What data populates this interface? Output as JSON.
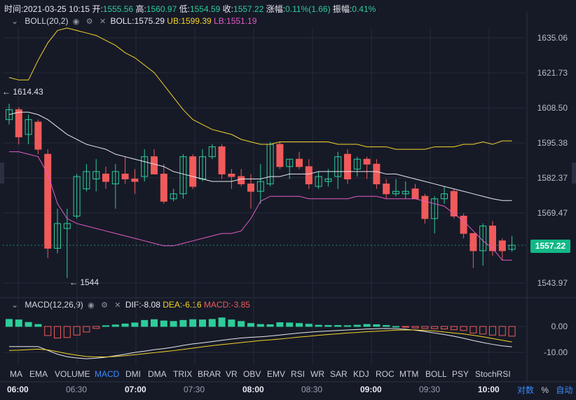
{
  "info": {
    "time_label": "时间:",
    "time": "2021-03-25 10:15",
    "open_label": "开:",
    "open": "1555.56",
    "high_label": "高:",
    "high": "1560.97",
    "low_label": "低:",
    "low": "1554.59",
    "close_label": "收:",
    "close": "1557.22",
    "change_label": "涨幅:",
    "change": "0.11%(1.66)",
    "amplitude_label": "振幅:",
    "amplitude": "0.41%"
  },
  "boll": {
    "name": "BOLL(20,2)",
    "mid": "BOLL:1575.29",
    "ub": "UB:1599.39",
    "lb": "LB:1551.19",
    "colors": {
      "mid": "#e8e8ee",
      "ub": "#f5d32a",
      "lb": "#e05bc4"
    }
  },
  "macd": {
    "name": "MACD(12,26,9)",
    "dif": "DIF:-8.08",
    "dea": "DEA:-6.16",
    "macd": "MACD:-3.85",
    "axis_labels": [
      "0.00",
      "-10.00"
    ]
  },
  "price_axis": {
    "labels": [
      "1635.06",
      "1621.73",
      "1608.50",
      "1595.38",
      "1582.37",
      "1569.47",
      "1543.97"
    ],
    "current": "1557.22"
  },
  "annotations": {
    "high_mark": "← 1614.43",
    "low_mark": "← 1544"
  },
  "tabs": [
    "MA",
    "EMA",
    "VOLUME",
    "MACD",
    "DMI",
    "DMA",
    "TRIX",
    "BRAR",
    "VR",
    "OBV",
    "EMV",
    "RSI",
    "WR",
    "SAR",
    "KDJ",
    "ROC",
    "MTM",
    "BOLL",
    "PSY",
    "StochRSI"
  ],
  "active_tab": "MACD",
  "time_axis": [
    {
      "label": "06:00",
      "major": true
    },
    {
      "label": "06:30",
      "major": false
    },
    {
      "label": "07:00",
      "major": true
    },
    {
      "label": "07:30",
      "major": false
    },
    {
      "label": "08:00",
      "major": true
    },
    {
      "label": "08:30",
      "major": false
    },
    {
      "label": "09:00",
      "major": true
    },
    {
      "label": "09:30",
      "major": false
    },
    {
      "label": "10:00",
      "major": true
    }
  ],
  "scale_buttons": {
    "log": "对数",
    "percent": "%",
    "auto": "自动"
  },
  "colors": {
    "up": "#2ecc9a",
    "down": "#f05a5a",
    "background": "#161a27",
    "grid": "#262b3a"
  },
  "chart_data": {
    "type": "candlestick",
    "ylim": [
      1538,
      1645
    ],
    "candles": [
      {
        "o": 1608,
        "h": 1614.4,
        "l": 1606,
        "c": 1612
      },
      {
        "o": 1612,
        "h": 1613,
        "l": 1598,
        "c": 1601
      },
      {
        "o": 1602,
        "h": 1610,
        "l": 1598,
        "c": 1608
      },
      {
        "o": 1607,
        "h": 1608,
        "l": 1594,
        "c": 1596
      },
      {
        "o": 1594,
        "h": 1596,
        "l": 1552,
        "c": 1556
      },
      {
        "o": 1556,
        "h": 1572,
        "l": 1554,
        "c": 1566
      },
      {
        "o": 1564,
        "h": 1572,
        "l": 1544,
        "c": 1566
      },
      {
        "o": 1569,
        "h": 1586,
        "l": 1568,
        "c": 1585
      },
      {
        "o": 1580,
        "h": 1590,
        "l": 1579,
        "c": 1587
      },
      {
        "o": 1584,
        "h": 1592,
        "l": 1579,
        "c": 1587
      },
      {
        "o": 1586,
        "h": 1589,
        "l": 1580,
        "c": 1583
      },
      {
        "o": 1582,
        "h": 1590,
        "l": 1572,
        "c": 1587
      },
      {
        "o": 1586,
        "h": 1593,
        "l": 1582,
        "c": 1584
      },
      {
        "o": 1584,
        "h": 1588,
        "l": 1578,
        "c": 1583
      },
      {
        "o": 1585,
        "h": 1596,
        "l": 1583,
        "c": 1593
      },
      {
        "o": 1593,
        "h": 1596,
        "l": 1586,
        "c": 1586
      },
      {
        "o": 1586,
        "h": 1590,
        "l": 1574,
        "c": 1575
      },
      {
        "o": 1576,
        "h": 1580,
        "l": 1575,
        "c": 1578
      },
      {
        "o": 1578,
        "h": 1594,
        "l": 1576,
        "c": 1593
      },
      {
        "o": 1593,
        "h": 1594,
        "l": 1580,
        "c": 1581
      },
      {
        "o": 1584,
        "h": 1596,
        "l": 1583,
        "c": 1593
      },
      {
        "o": 1593,
        "h": 1598,
        "l": 1592,
        "c": 1597
      },
      {
        "o": 1597,
        "h": 1598,
        "l": 1584,
        "c": 1586
      },
      {
        "o": 1586,
        "h": 1588,
        "l": 1580,
        "c": 1585
      },
      {
        "o": 1585,
        "h": 1588,
        "l": 1581,
        "c": 1582
      },
      {
        "o": 1582,
        "h": 1586,
        "l": 1572,
        "c": 1579
      },
      {
        "o": 1579,
        "h": 1590,
        "l": 1574,
        "c": 1583
      },
      {
        "o": 1582,
        "h": 1599,
        "l": 1581,
        "c": 1598
      },
      {
        "o": 1598,
        "h": 1599,
        "l": 1588,
        "c": 1589
      },
      {
        "o": 1589,
        "h": 1592,
        "l": 1584,
        "c": 1592
      },
      {
        "o": 1592,
        "h": 1595,
        "l": 1588,
        "c": 1589
      },
      {
        "o": 1589,
        "h": 1592,
        "l": 1580,
        "c": 1582
      },
      {
        "o": 1581,
        "h": 1587,
        "l": 1580,
        "c": 1585
      },
      {
        "o": 1583,
        "h": 1588,
        "l": 1581,
        "c": 1584
      },
      {
        "o": 1585,
        "h": 1595,
        "l": 1580,
        "c": 1593
      },
      {
        "o": 1594,
        "h": 1596,
        "l": 1582,
        "c": 1584
      },
      {
        "o": 1588,
        "h": 1593,
        "l": 1585,
        "c": 1592
      },
      {
        "o": 1592,
        "h": 1593,
        "l": 1584,
        "c": 1590
      },
      {
        "o": 1590,
        "h": 1592,
        "l": 1580,
        "c": 1582
      },
      {
        "o": 1582,
        "h": 1584,
        "l": 1576,
        "c": 1578
      },
      {
        "o": 1578,
        "h": 1584,
        "l": 1577,
        "c": 1579
      },
      {
        "o": 1578,
        "h": 1583,
        "l": 1576,
        "c": 1579
      },
      {
        "o": 1580,
        "h": 1582,
        "l": 1576,
        "c": 1576
      },
      {
        "o": 1577,
        "h": 1578,
        "l": 1566,
        "c": 1568
      },
      {
        "o": 1568,
        "h": 1577,
        "l": 1562,
        "c": 1576
      },
      {
        "o": 1576,
        "h": 1581,
        "l": 1574,
        "c": 1578
      },
      {
        "o": 1579,
        "h": 1580,
        "l": 1568,
        "c": 1569
      },
      {
        "o": 1569,
        "h": 1570,
        "l": 1560,
        "c": 1562
      },
      {
        "o": 1562,
        "h": 1560,
        "l": 1548,
        "c": 1555
      },
      {
        "o": 1555,
        "h": 1566,
        "l": 1549,
        "c": 1565
      },
      {
        "o": 1565,
        "h": 1567,
        "l": 1553,
        "c": 1555
      },
      {
        "o": 1559,
        "h": 1560,
        "l": 1551,
        "c": 1555
      },
      {
        "o": 1555.56,
        "h": 1560.97,
        "l": 1554.59,
        "c": 1557.22
      }
    ],
    "boll_mid": [
      1610,
      1611,
      1611,
      1610,
      1608,
      1605,
      1602,
      1600,
      1598,
      1597,
      1596,
      1594,
      1593,
      1592,
      1591,
      1590,
      1589,
      1587,
      1586,
      1585,
      1584,
      1583,
      1583,
      1583,
      1584,
      1584,
      1584,
      1585,
      1585,
      1586,
      1586,
      1586,
      1587,
      1587,
      1587,
      1587,
      1587,
      1587,
      1587,
      1586,
      1586,
      1585,
      1584,
      1583,
      1582,
      1581,
      1580,
      1579,
      1578,
      1577,
      1576,
      1575.29,
      1575.29
    ],
    "boll_ub": [
      1625,
      1624,
      1624,
      1632,
      1639,
      1644,
      1645,
      1644,
      1643,
      1642,
      1640,
      1638,
      1635,
      1633,
      1630,
      1627,
      1622,
      1617,
      1612,
      1608,
      1606,
      1604,
      1603,
      1602,
      1600,
      1599,
      1598,
      1598,
      1599,
      1599,
      1599,
      1599,
      1599,
      1599,
      1598,
      1598,
      1598,
      1597,
      1597,
      1597,
      1596,
      1596,
      1596,
      1596,
      1597,
      1597,
      1597,
      1598,
      1598,
      1599,
      1598,
      1599.39,
      1599.39
    ],
    "boll_lb": [
      1595,
      1595,
      1594,
      1593,
      1586,
      1574,
      1568,
      1566,
      1565,
      1564,
      1563,
      1562,
      1561,
      1560,
      1559,
      1558,
      1557,
      1557,
      1558,
      1559,
      1560,
      1561,
      1562,
      1562,
      1563,
      1568,
      1575,
      1577,
      1577,
      1577,
      1577,
      1576,
      1576,
      1576,
      1576,
      1576,
      1577,
      1577,
      1577,
      1576,
      1576,
      1576,
      1576,
      1575,
      1574,
      1573,
      1570,
      1567,
      1563,
      1559,
      1556,
      1551.19,
      1551.19
    ],
    "macd_hist": [
      2.8,
      2.6,
      1.6,
      0.8,
      -3.6,
      -4.6,
      -4.4,
      -3.4,
      -2.2,
      -0.8,
      0.3,
      0.6,
      1.0,
      1.4,
      2.4,
      2.7,
      2.2,
      2.0,
      2.4,
      2.7,
      2.6,
      2.8,
      3.4,
      2.6,
      2.0,
      1.2,
      0.8,
      0.7,
      1.5,
      1.4,
      1.2,
      0.9,
      0.5,
      0.4,
      0.4,
      0.3,
      0.5,
      0.8,
      0.7,
      0.4,
      0.0,
      -0.3,
      -0.6,
      -0.8,
      -0.9,
      -1.0,
      -1.3,
      -1.6,
      -2.6,
      -3.0,
      -3.4,
      -3.6,
      -3.85
    ],
    "macd_dif": [
      -8,
      -8,
      -8,
      -8,
      -9.5,
      -11,
      -12,
      -12.5,
      -12.8,
      -12.6,
      -12.2,
      -11.6,
      -11,
      -10.3,
      -9.8,
      -9.2,
      -8.8,
      -8.2,
      -7.5,
      -6.9,
      -6.5,
      -6.0,
      -5.5,
      -5.0,
      -4.6,
      -4.3,
      -4.1,
      -3.8,
      -3.4,
      -3.0,
      -2.6,
      -2.3,
      -2.0,
      -1.8,
      -1.6,
      -1.4,
      -1.2,
      -1.0,
      -0.9,
      -0.8,
      -0.9,
      -1.1,
      -1.5,
      -2.0,
      -2.6,
      -3.2,
      -3.9,
      -4.7,
      -5.6,
      -6.4,
      -7.1,
      -7.7,
      -8.08
    ],
    "macd_dea": [
      -9.5,
      -9.4,
      -9.2,
      -9.0,
      -9.3,
      -10.0,
      -10.8,
      -11.4,
      -11.9,
      -12.1,
      -12.1,
      -11.9,
      -11.6,
      -11.2,
      -10.8,
      -10.4,
      -10.0,
      -9.6,
      -9.1,
      -8.6,
      -8.1,
      -7.6,
      -7.2,
      -6.8,
      -6.4,
      -6.0,
      -5.6,
      -5.3,
      -5.0,
      -4.6,
      -4.2,
      -3.9,
      -3.5,
      -3.2,
      -2.9,
      -2.6,
      -2.4,
      -2.1,
      -1.9,
      -1.7,
      -1.5,
      -1.4,
      -1.4,
      -1.6,
      -1.8,
      -2.2,
      -2.6,
      -3.0,
      -3.5,
      -4.1,
      -4.8,
      -5.5,
      -6.16
    ]
  }
}
